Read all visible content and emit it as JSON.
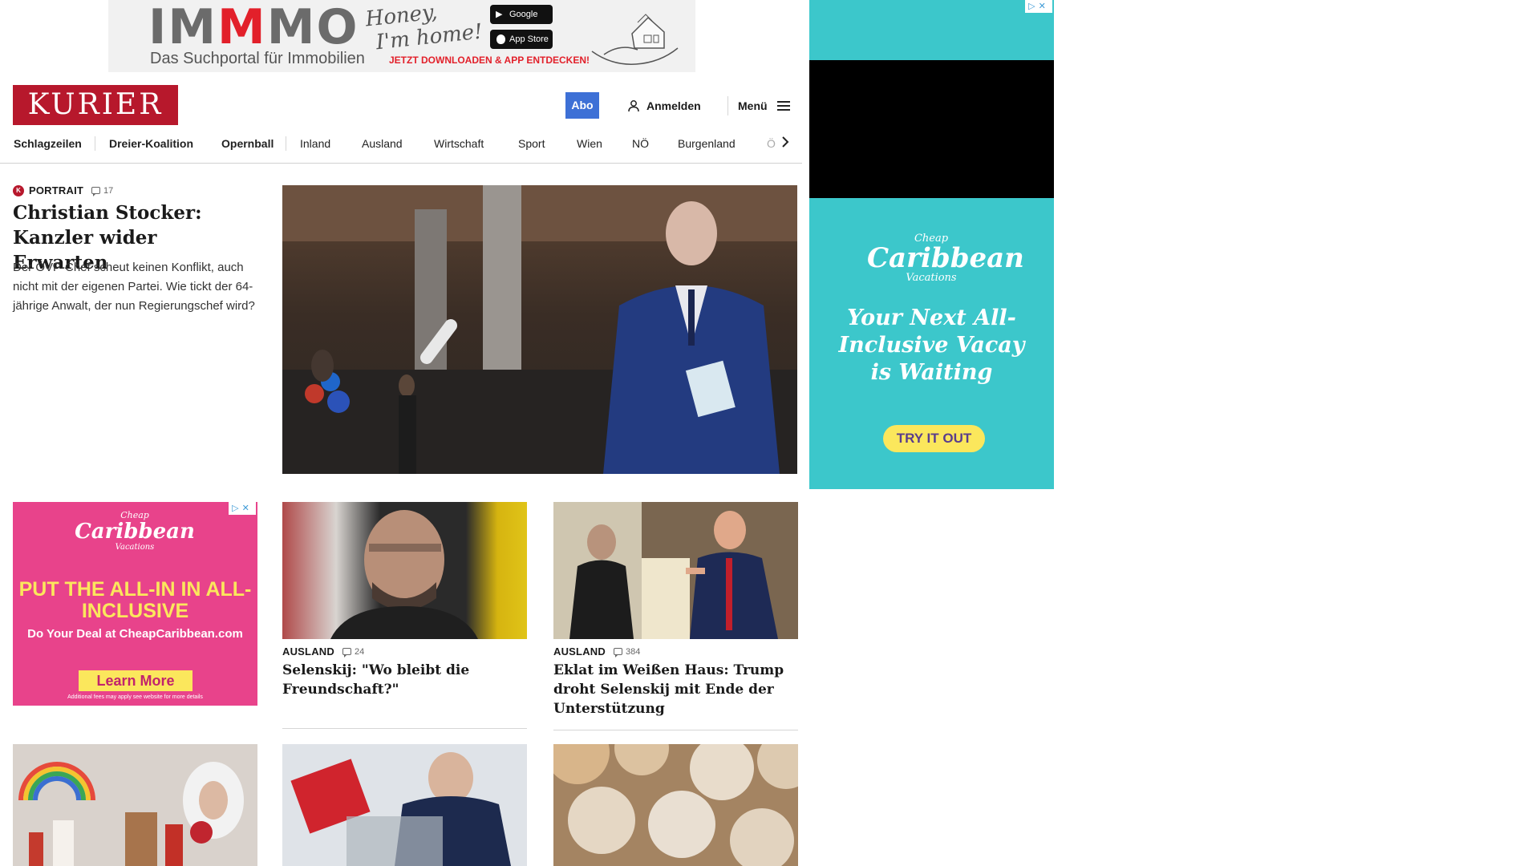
{
  "top_ad": {
    "brand_prefix": "IM",
    "brand_accent": "M",
    "brand_suffix": "MO",
    "tagline": "Das Suchportal für Immobilien",
    "script_line_1": "Honey,",
    "script_line_2": "I'm home!",
    "google_play_label": "Google Play",
    "app_store_label": "App Store",
    "cta": "JETZT DOWNLOADEN & APP ENTDECKEN!"
  },
  "header": {
    "logo": "KURIER",
    "abo_label": "Abo",
    "login_label": "Anmelden",
    "menu_label": "Menü"
  },
  "nav": {
    "items": [
      "Schlagzeilen",
      "Dreier-Koalition",
      "Opernball",
      "Inland",
      "Ausland",
      "Wirtschaft",
      "Sport",
      "Wien",
      "NÖ",
      "Burgenland",
      "Ö"
    ],
    "more_icon": "chevron-right-icon"
  },
  "lead": {
    "badge": "K",
    "kicker": "PORTRAIT",
    "comments": "17",
    "title": "Christian Stocker: Kanzler wider Erwarten",
    "teaser": "Der ÖVP-Chef scheut keinen Konflikt, auch nicht mit der eigenen Partei. Wie tickt der 64-jährige Anwalt, der nun Regierungschef wird?"
  },
  "side_ad": {
    "logo_small_top": "Cheap",
    "logo_large": "Caribbean",
    "logo_small_bottom": "Vacations",
    "text": "Your Next All-Inclusive Vacay is Waiting",
    "button": "TRY IT OUT",
    "adchoice": "▷✕"
  },
  "left_ad": {
    "logo_small_top": "Cheap",
    "logo_large": "Caribbean",
    "logo_small_bottom": "Vacations",
    "headline": "PUT THE ALL-IN IN ALL-INCLUSIVE",
    "sub": "Do Your Deal at CheapCaribbean.com",
    "button": "Learn More",
    "fine_print": "Additional fees may apply see website for more details",
    "adchoice": "▷✕"
  },
  "cards": [
    {
      "kicker": "AUSLAND",
      "comments": "24",
      "title": "Selenskij: \"Wo bleibt die Freundschaft?\""
    },
    {
      "kicker": "AUSLAND",
      "comments": "384",
      "title": "Eklat im Weißen Haus: Trump droht Selenskij mit Ende der Unterstützung"
    }
  ],
  "colors": {
    "brand": "#b7182c",
    "abo_button": "#3d70d6",
    "side_ad_teal": "#3cc7cb",
    "left_ad_pink": "#e8438b",
    "ad_yellow": "#fbe75c"
  }
}
